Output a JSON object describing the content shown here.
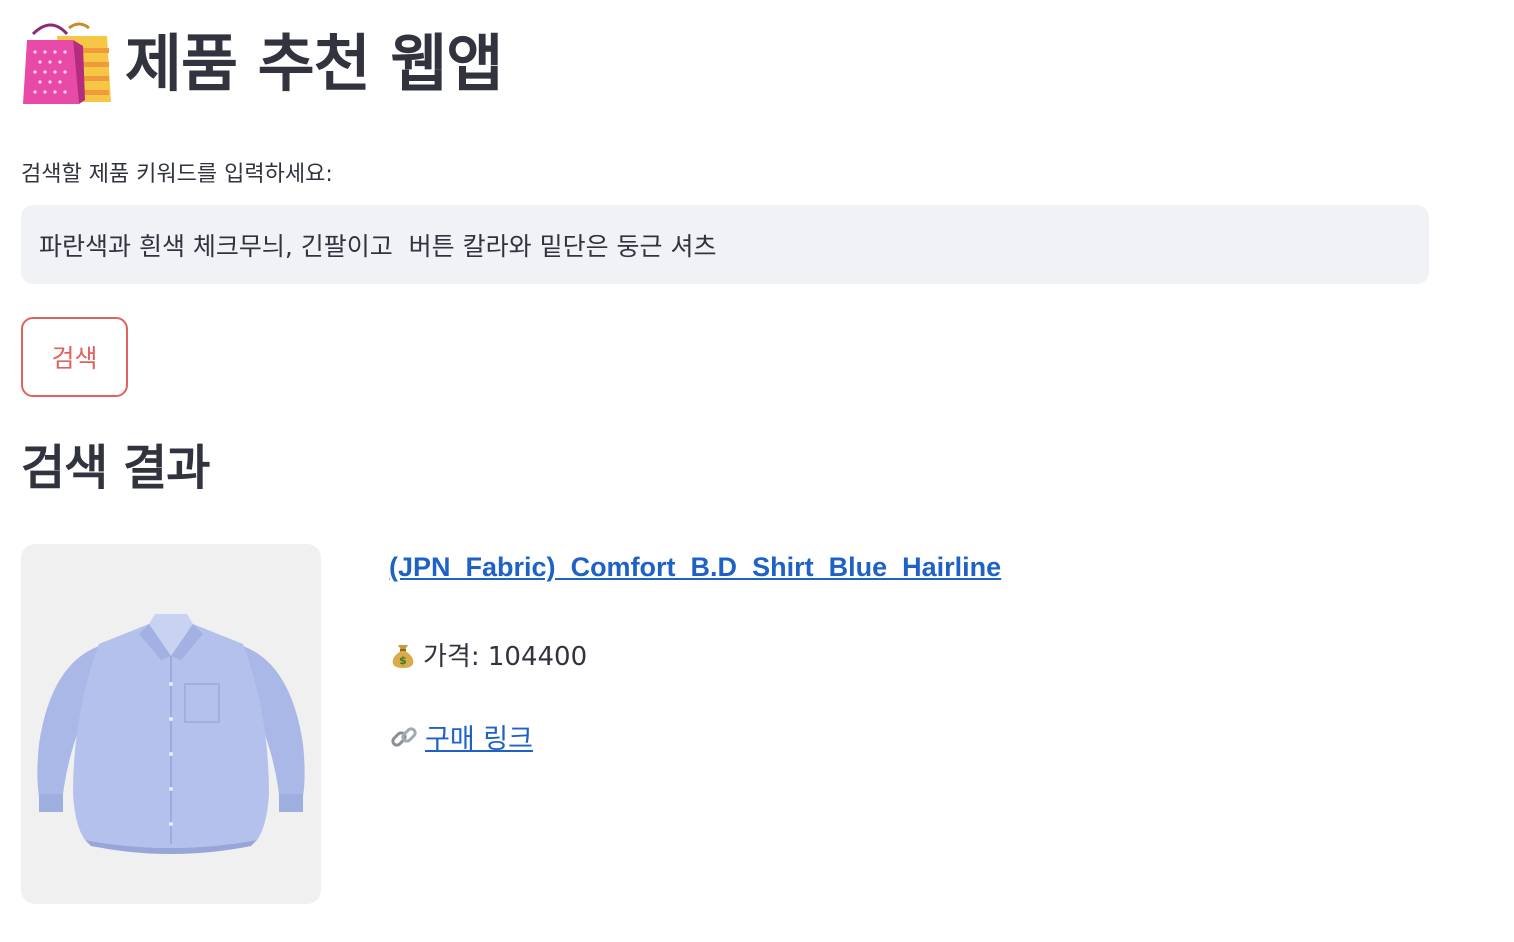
{
  "header": {
    "icon": "shopping-bags-icon",
    "title": "제품 추천 웹앱"
  },
  "search": {
    "label": "검색할 제품 키워드를 입력하세요:",
    "value": "파란색과 흰색 체크무늬, 긴팔이고  버튼 칼라와 밑단은 둥근 셔츠",
    "button_label": "검색"
  },
  "results": {
    "heading": "검색 결과",
    "items": [
      {
        "image_icon": "blue-shirt-image",
        "title": "(JPN_Fabric)_Comfort_B.D_Shirt_Blue_Hairline",
        "price_icon": "money-bag-icon",
        "price_label": "가격: 104400",
        "link_icon": "link-icon",
        "link_label": "구매 링크"
      }
    ]
  },
  "colors": {
    "accent": "#e0625d",
    "link": "#1e62c6",
    "text": "#31333f",
    "input_bg": "#f0f2f6"
  }
}
